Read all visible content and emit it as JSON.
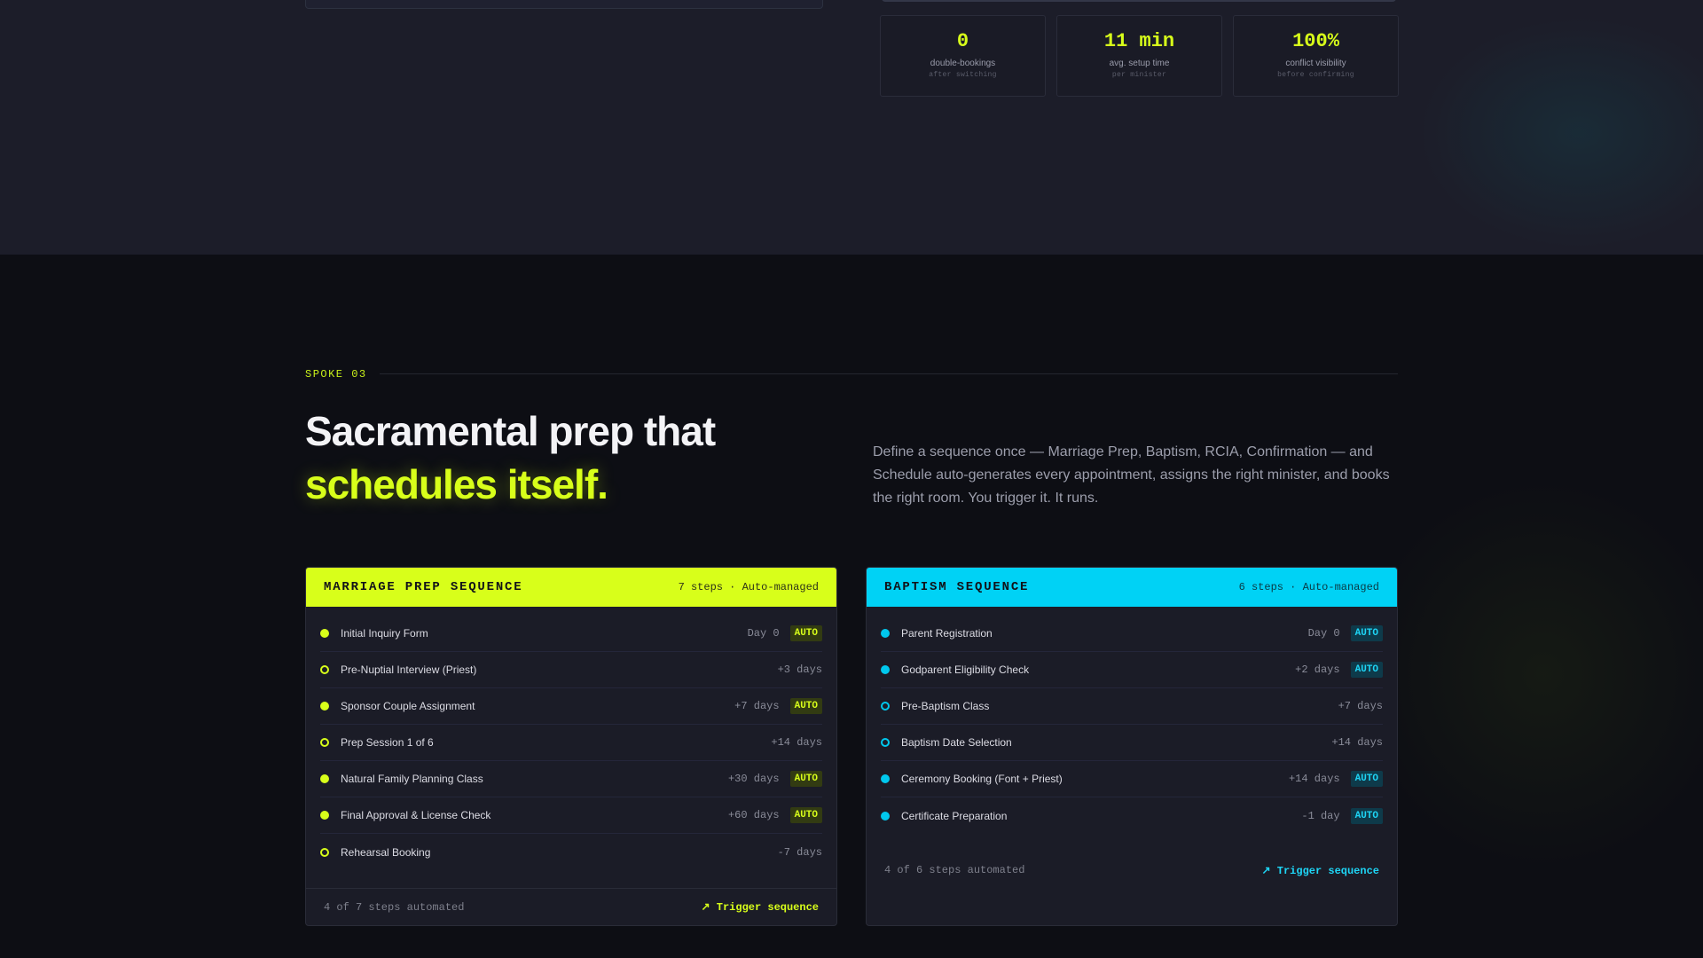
{
  "top_stats": [
    {
      "value": "0",
      "label": "double-bookings",
      "sub": "after switching"
    },
    {
      "value": "11 min",
      "label": "avg. setup time",
      "sub": "per minister"
    },
    {
      "value": "100%",
      "label": "conflict visibility",
      "sub": "before confirming"
    }
  ],
  "section": {
    "eyebrow": "SPOKE 03",
    "headline_line1": "Sacramental prep that",
    "headline_line2": "schedules itself.",
    "intro": "Define a sequence once — Marriage Prep, Baptism, RCIA, Confirmation — and Schedule auto-generates every appointment, assigns the right minister, and books the right room. You trigger it. It runs."
  },
  "marriage": {
    "title": "MARRIAGE PREP SEQUENCE",
    "meta": "7 steps · Auto-managed",
    "steps": [
      {
        "name": "Initial Inquiry Form",
        "day": "Day 0",
        "auto": "AUTO"
      },
      {
        "name": "Pre-Nuptial Interview (Priest)",
        "day": "+3 days",
        "auto": ""
      },
      {
        "name": "Sponsor Couple Assignment",
        "day": "+7 days",
        "auto": "AUTO"
      },
      {
        "name": "Prep Session 1 of 6",
        "day": "+14 days",
        "auto": ""
      },
      {
        "name": "Natural Family Planning Class",
        "day": "+30 days",
        "auto": "AUTO"
      },
      {
        "name": "Final Approval & License Check",
        "day": "+60 days",
        "auto": "AUTO"
      },
      {
        "name": "Rehearsal Booking",
        "day": "-7 days",
        "auto": ""
      }
    ],
    "footer_count": "4 of 7 steps automated",
    "trigger": "↗ Trigger sequence"
  },
  "baptism": {
    "title": "BAPTISM SEQUENCE",
    "meta": "6 steps · Auto-managed",
    "steps": [
      {
        "name": "Parent Registration",
        "day": "Day 0",
        "auto": "AUTO"
      },
      {
        "name": "Godparent Eligibility Check",
        "day": "+2 days",
        "auto": "AUTO"
      },
      {
        "name": "Pre-Baptism Class",
        "day": "+7 days",
        "auto": ""
      },
      {
        "name": "Baptism Date Selection",
        "day": "+14 days",
        "auto": ""
      },
      {
        "name": "Ceremony Booking (Font + Priest)",
        "day": "+14 days",
        "auto": "AUTO"
      },
      {
        "name": "Certificate Preparation",
        "day": "-1 day",
        "auto": "AUTO"
      }
    ],
    "footer_count": "4 of 6 steps automated",
    "trigger": "↗ Trigger sequence"
  },
  "colors": {
    "accent_lime": "#d8ff1a",
    "accent_cyan": "#00d2f5",
    "background": "#0d0e14"
  }
}
